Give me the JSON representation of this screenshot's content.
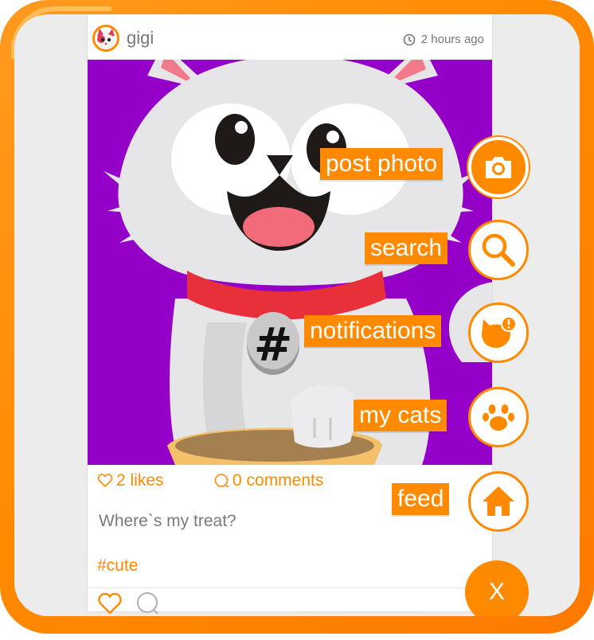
{
  "post": {
    "username": "gigi",
    "timestamp": "2 hours ago",
    "photo_tag": "#",
    "likes": "2 likes",
    "comments": "0 comments",
    "caption": "Where`s my treat?",
    "hashtag": "#cute"
  },
  "menu": {
    "items": [
      {
        "label": "post photo",
        "icon": "camera-icon"
      },
      {
        "label": "search",
        "icon": "search-icon"
      },
      {
        "label": "notifications",
        "icon": "cat-alert-icon"
      },
      {
        "label": "my cats",
        "icon": "paw-icon"
      },
      {
        "label": "feed",
        "icon": "home-icon"
      }
    ],
    "close_label": "X"
  },
  "colors": {
    "accent": "#ff8a00",
    "photo_background": "#9500c9",
    "screen": "#ececec"
  }
}
